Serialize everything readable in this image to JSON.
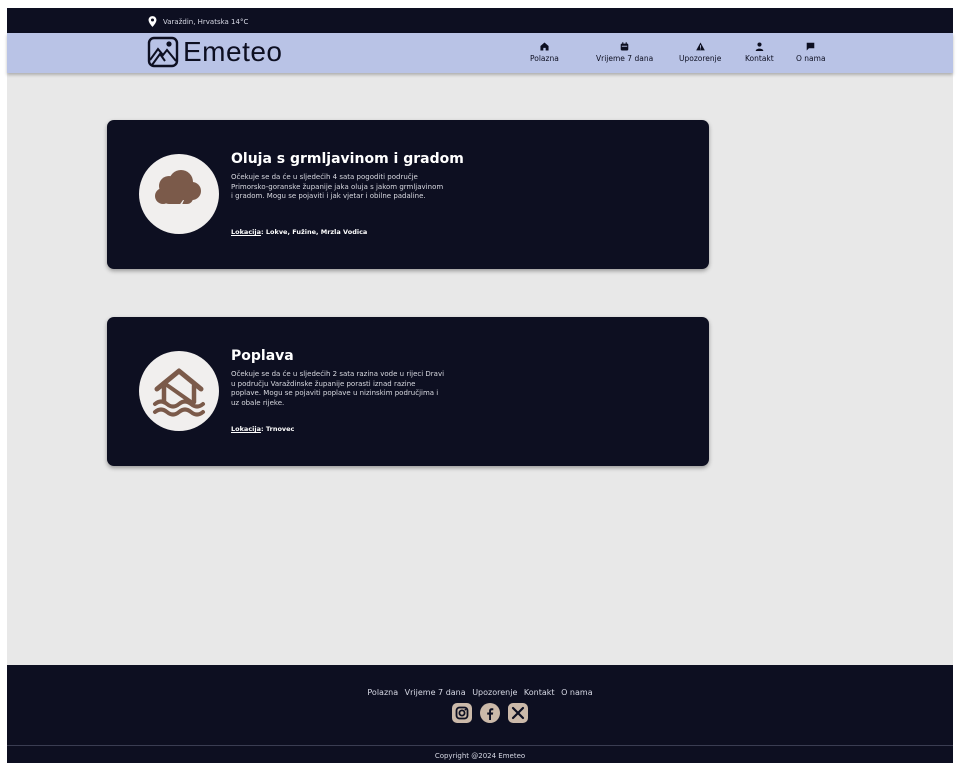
{
  "topbar": {
    "location": "Varaždin, Hrvatska 14°C"
  },
  "brand": {
    "name": "Emeteo"
  },
  "nav": [
    {
      "label": "Polazna",
      "icon": "home-icon"
    },
    {
      "label": "Vrijeme 7 dana",
      "icon": "calendar-icon"
    },
    {
      "label": "Upozorenje",
      "icon": "warning-icon"
    },
    {
      "label": "Kontakt",
      "icon": "person-icon"
    },
    {
      "label": "O nama",
      "icon": "chat-icon"
    }
  ],
  "alerts": [
    {
      "title": "Oluja s grmljavinom i gradom",
      "description": "Očekuje se da će u sljedećih 4 sata pogoditi područje Primorsko-goranske županije jaka oluja s jakom grmljavinom i gradom. Mogu se pojaviti i jak vjetar i obilne padaline.",
      "location_label": "Lokacija",
      "location": "Lokve, Fužine, Mrzla Vodica",
      "icon": "storm-cloud-icon"
    },
    {
      "title": "Poplava",
      "description": "Očekuje se da će u sljedećih 2 sata razina vode u rijeci Dravi u području Varaždinske županije porasti iznad razine poplave. Mogu se pojaviti poplave u nizinskim područjima i uz obale rijeke.",
      "location_label": "Lokacija",
      "location": "Trnovec",
      "icon": "flood-house-icon"
    }
  ],
  "footer": {
    "links": [
      "Polazna",
      "Vrijeme 7 dana",
      "Upozorenje",
      "Kontakt",
      "O nama"
    ],
    "social": [
      "instagram-icon",
      "facebook-icon",
      "x-icon"
    ],
    "copyright": "Copyright @2024 Emeteo"
  },
  "colors": {
    "dark": "#0d0f21",
    "nav": "#b9c3e6",
    "background": "#e8e8e8",
    "icon_brown": "#7b5a4a",
    "social": "#cbb9a9"
  }
}
